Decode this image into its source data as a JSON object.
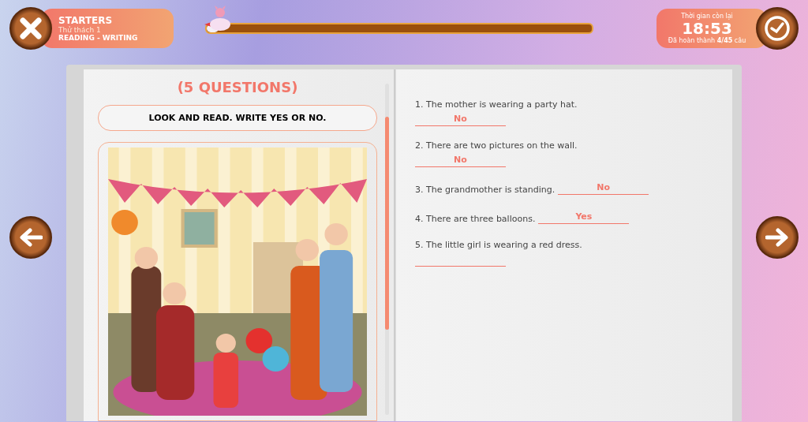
{
  "header": {
    "level_title": "STARTERS",
    "challenge": "Thử thách 1",
    "skill": "READING - WRITING"
  },
  "progress": {
    "level": 0.03
  },
  "timer": {
    "label": "Thời gian còn lại",
    "time": "18:53",
    "done_prefix": "Đã hoàn thành",
    "done_count": "4/45",
    "done_suffix": "câu"
  },
  "left_page": {
    "heading": "(5 QUESTIONS)",
    "instruction": "LOOK AND READ. WRITE YES OR NO."
  },
  "questions": [
    {
      "kind": "block",
      "text": "1. The mother is wearing a party hat.",
      "answer": "No"
    },
    {
      "kind": "block",
      "text": "2. There are two pictures on the wall.",
      "answer": "No"
    },
    {
      "kind": "inline",
      "text": "3. The grandmother is standing.",
      "answer": "No"
    },
    {
      "kind": "inline",
      "text": "4. There are three balloons.",
      "answer": "Yes"
    },
    {
      "kind": "block",
      "text": "5. The little girl is wearing a red dress."
    }
  ]
}
